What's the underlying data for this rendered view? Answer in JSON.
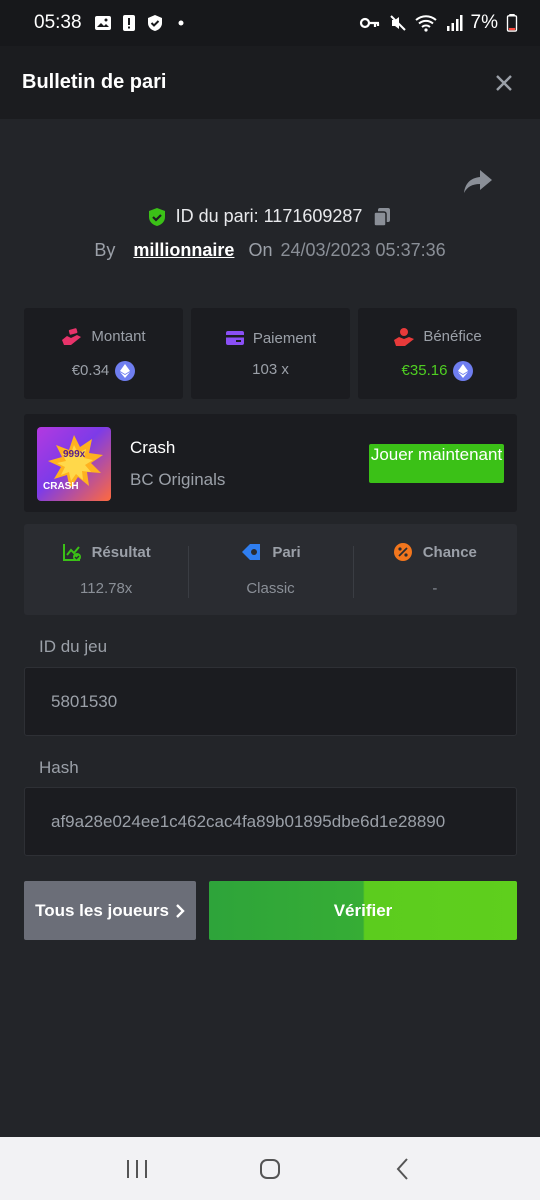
{
  "status_bar": {
    "time": "05:38",
    "battery": "7%"
  },
  "header": {
    "title": "Bulletin de pari"
  },
  "bet": {
    "id_label": "ID du pari: 1171609287",
    "by_label": "By",
    "user": "millionnaire",
    "on_label": "On",
    "date": "24/03/2023 05:37:36"
  },
  "stats": [
    {
      "label": "Montant",
      "value": "€0.34"
    },
    {
      "label": "Paiement",
      "value": "103 x"
    },
    {
      "label": "Bénéfice",
      "value": "€35.16"
    }
  ],
  "game": {
    "thumb_badge": "999x",
    "thumb_label": "CRASH",
    "name": "Crash",
    "provider": "BC Originals",
    "play_label": "Jouer maintenant"
  },
  "result": [
    {
      "label": "Résultat",
      "value": "112.78x"
    },
    {
      "label": "Pari",
      "value": "Classic"
    },
    {
      "label": "Chance",
      "value": "-"
    }
  ],
  "fields": {
    "game_id_label": "ID du jeu",
    "game_id_value": "5801530",
    "hash_label": "Hash",
    "hash_value": "af9a28e024ee1c462cac4fa89b01895dbe6d1e28890"
  },
  "buttons": {
    "all_players": "Tous les joueurs",
    "verify": "Vérifier"
  },
  "colors": {
    "positive": "#4fcf22",
    "primary_button": "#3bc117",
    "secondary_button": "#6b6e78"
  }
}
